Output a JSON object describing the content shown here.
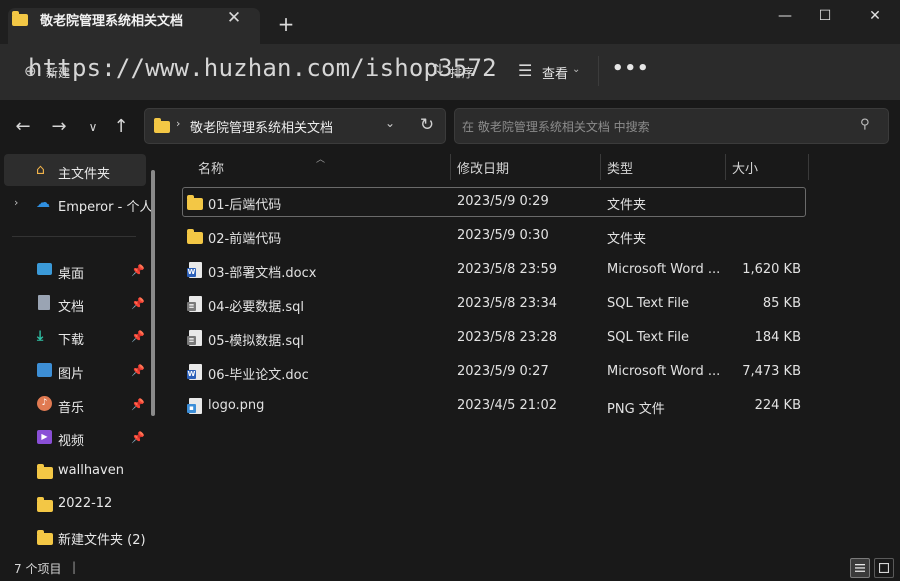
{
  "window": {
    "tab_title": "敬老院管理系统相关文档",
    "tab_close": "✕",
    "new_tab": "+",
    "minimize": "—",
    "maximize": "☐",
    "close": "✕"
  },
  "commandbar": {
    "new_label": "新建",
    "sort_label": "排序",
    "view_label": "查看",
    "more_label": "•••",
    "watermark": "https://www.huzhan.com/ishop3572"
  },
  "nav": {
    "back": "←",
    "forward": "→",
    "recent": "∨",
    "up": "↑",
    "address_path": "敬老院管理系统相关文档",
    "refresh": "↻",
    "search_placeholder": "在 敬老院管理系统相关文档 中搜索"
  },
  "sidebar": {
    "items": [
      {
        "label": "主文件夹",
        "icon": "home-icon",
        "selected": true
      },
      {
        "label": "Emperor - 个人",
        "icon": "onedrive-cloud-icon"
      },
      {
        "label": "桌面",
        "icon": "desktop-icon",
        "pinned": true
      },
      {
        "label": "文档",
        "icon": "documents-icon",
        "pinned": true
      },
      {
        "label": "下载",
        "icon": "download-icon",
        "pinned": true
      },
      {
        "label": "图片",
        "icon": "pictures-icon",
        "pinned": true
      },
      {
        "label": "音乐",
        "icon": "music-icon",
        "pinned": true
      },
      {
        "label": "视频",
        "icon": "videos-icon",
        "pinned": true
      },
      {
        "label": "wallhaven",
        "icon": "folder-icon"
      },
      {
        "label": "2022-12",
        "icon": "folder-icon"
      },
      {
        "label": "新建文件夹 (2)",
        "icon": "folder-icon"
      }
    ]
  },
  "filelist": {
    "columns": {
      "name": "名称",
      "modified": "修改日期",
      "type": "类型",
      "size": "大小"
    },
    "rows": [
      {
        "name": "01-后端代码",
        "modified": "2023/5/9 0:29",
        "type": "文件夹",
        "size": "",
        "icon": "folder-icon"
      },
      {
        "name": "02-前端代码",
        "modified": "2023/5/9 0:30",
        "type": "文件夹",
        "size": "",
        "icon": "folder-icon"
      },
      {
        "name": "03-部署文档.docx",
        "modified": "2023/5/8 23:59",
        "type": "Microsoft Word ...",
        "size": "1,620 KB",
        "icon": "word-doc-icon"
      },
      {
        "name": "04-必要数据.sql",
        "modified": "2023/5/8 23:34",
        "type": "SQL Text File",
        "size": "85 KB",
        "icon": "sql-file-icon"
      },
      {
        "name": "05-模拟数据.sql",
        "modified": "2023/5/8 23:28",
        "type": "SQL Text File",
        "size": "184 KB",
        "icon": "sql-file-icon"
      },
      {
        "name": "06-毕业论文.doc",
        "modified": "2023/5/9 0:27",
        "type": "Microsoft Word ...",
        "size": "7,473 KB",
        "icon": "word-doc-icon"
      },
      {
        "name": "logo.png",
        "modified": "2023/4/5 21:02",
        "type": "PNG 文件",
        "size": "224 KB",
        "icon": "png-image-icon"
      }
    ]
  },
  "statusbar": {
    "item_count": "7 个项目",
    "separator": "|"
  },
  "colors": {
    "folder": "#f3c745",
    "background": "#191919",
    "commandbar": "#2b2b2b",
    "word_badge": "#2b5fb8"
  }
}
